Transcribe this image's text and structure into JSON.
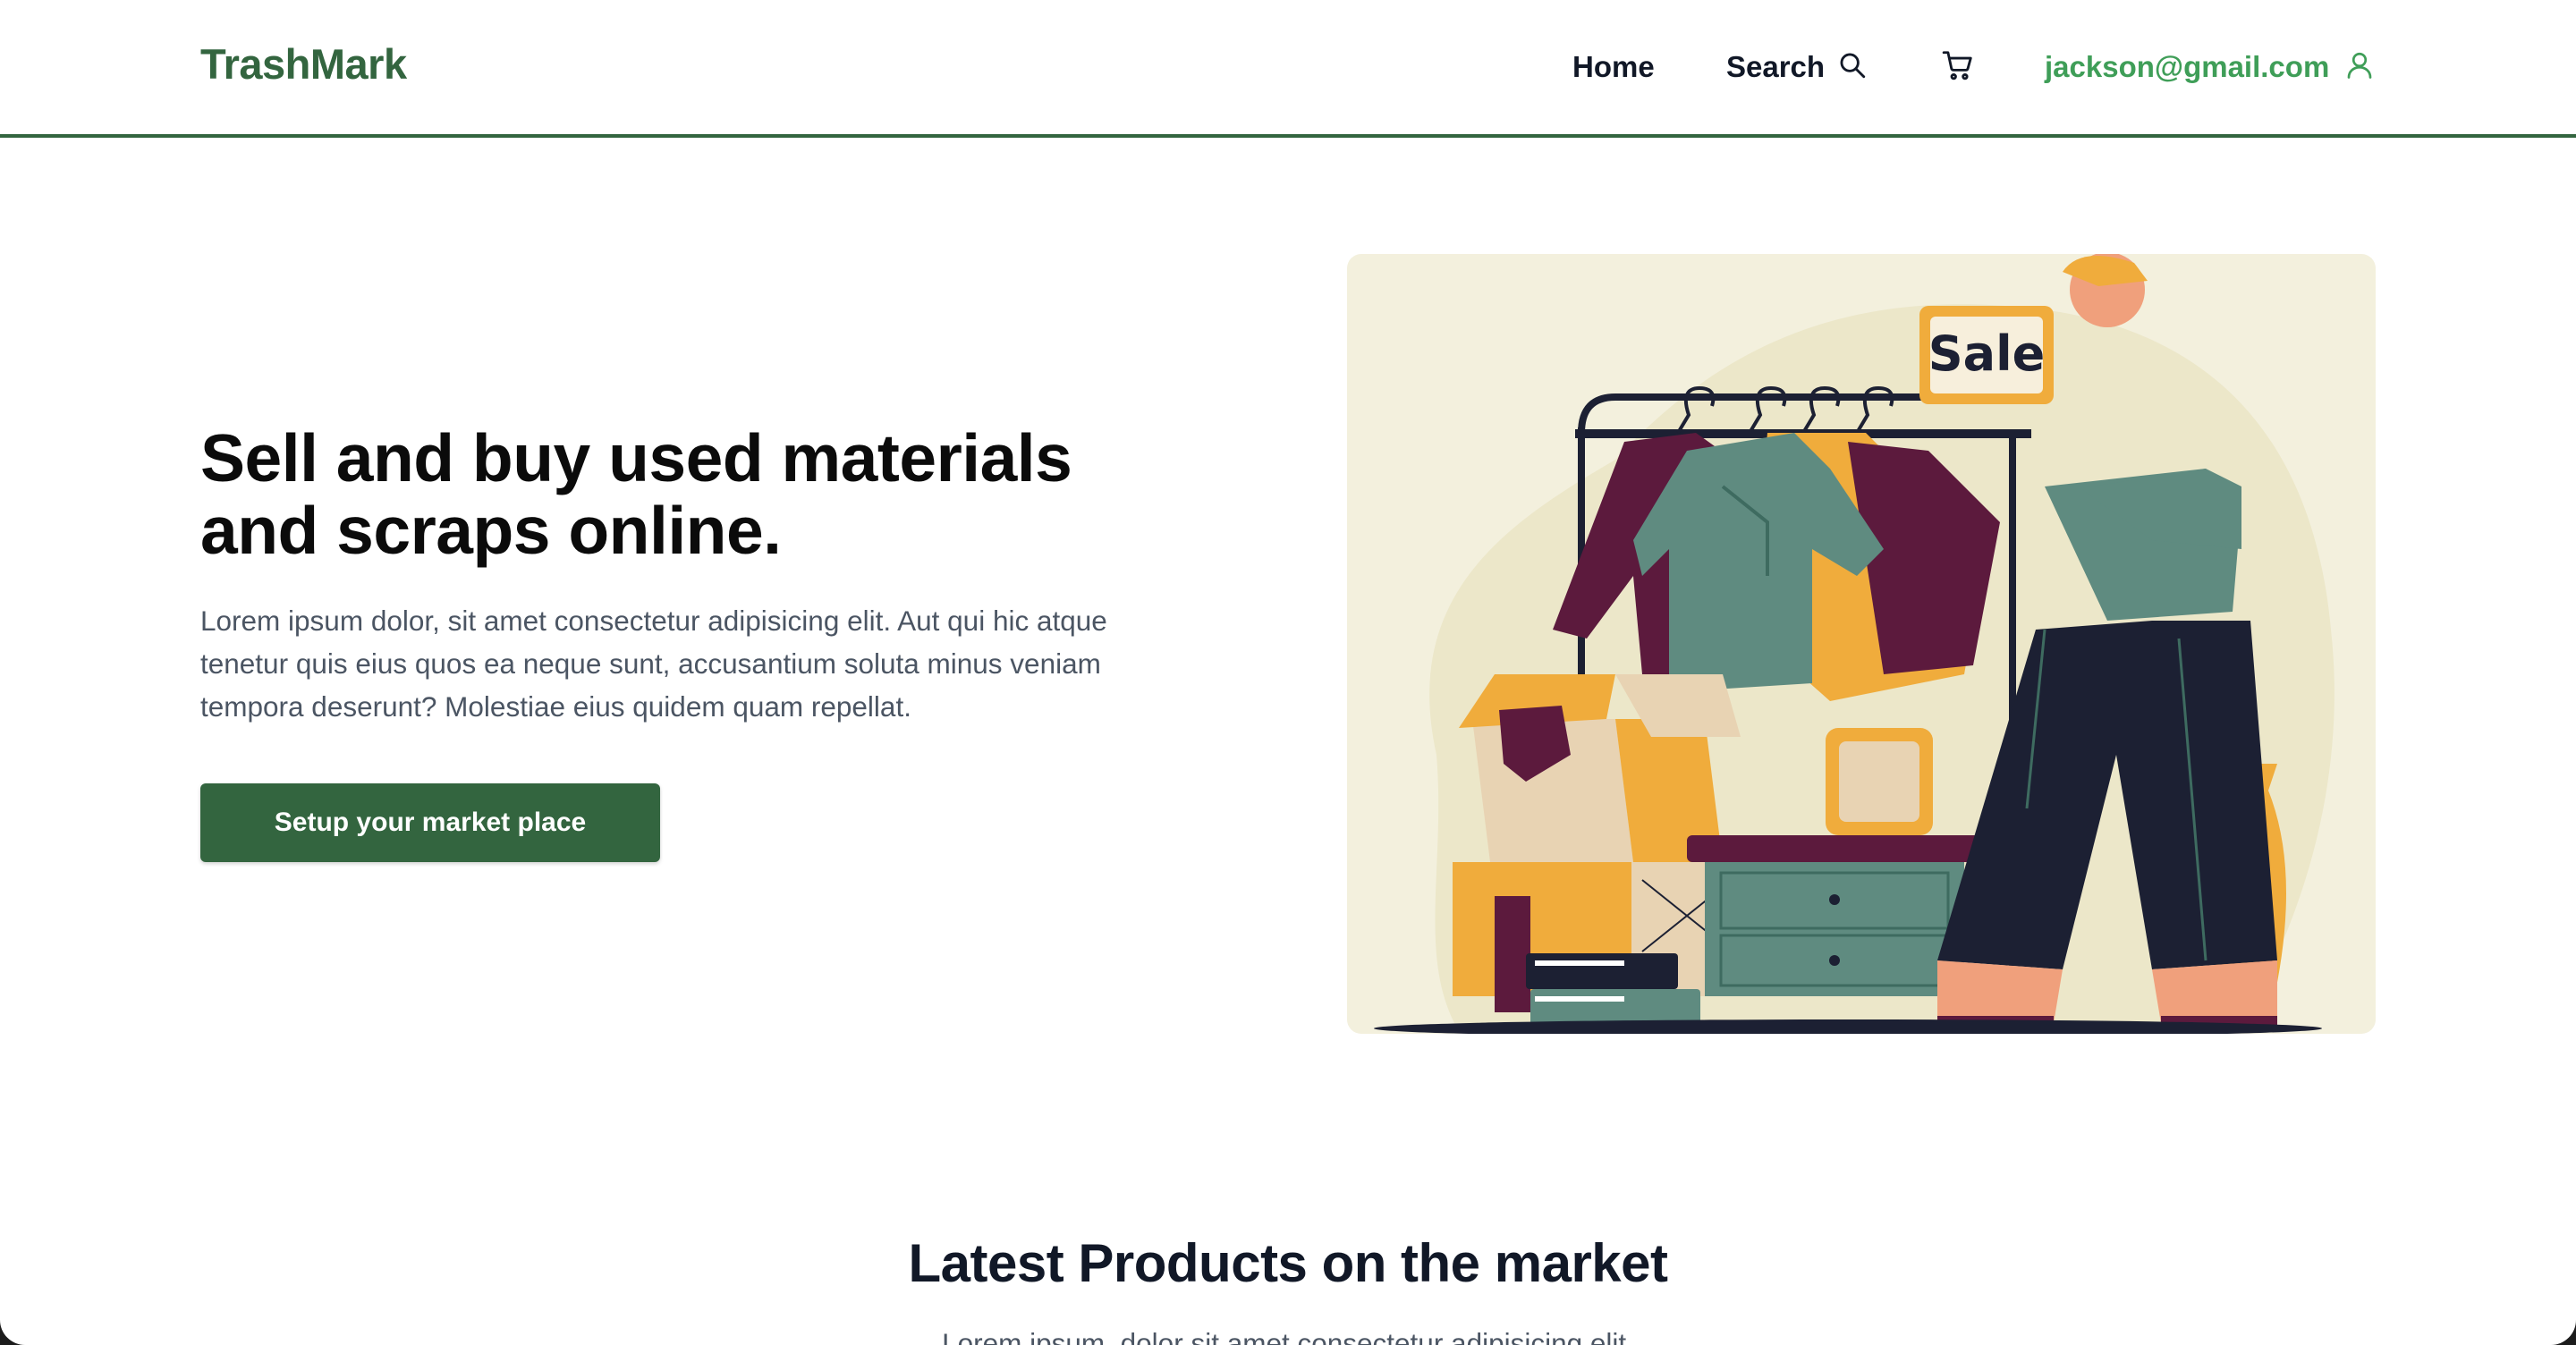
{
  "header": {
    "logo": "TrashMark",
    "nav": {
      "home": "Home",
      "search": "Search",
      "user_email": "jackson@gmail.com"
    },
    "icons": [
      "search-icon",
      "cart-icon",
      "user-icon"
    ]
  },
  "hero": {
    "title": "Sell and buy used materials and scraps online.",
    "body": "Lorem ipsum dolor, sit amet consectetur adipisicing elit. Aut qui hic atque tenetur quis eius quos ea neque sunt, accusantium soluta minus veniam tempora deserunt? Molestiae eius quidem quam repellat.",
    "cta_label": "Setup your market place",
    "image_sign_text": "Sale"
  },
  "latest": {
    "title": "Latest Products on the market",
    "subtitle": "Lorem ipsum, dolor sit amet consectetur adipisicing elit."
  },
  "colors": {
    "brand_green": "#33653f",
    "user_green": "#3f9e58",
    "text_dark": "#111827",
    "text_muted": "#4b5563",
    "illustration_bg": "#f3f0dd"
  }
}
